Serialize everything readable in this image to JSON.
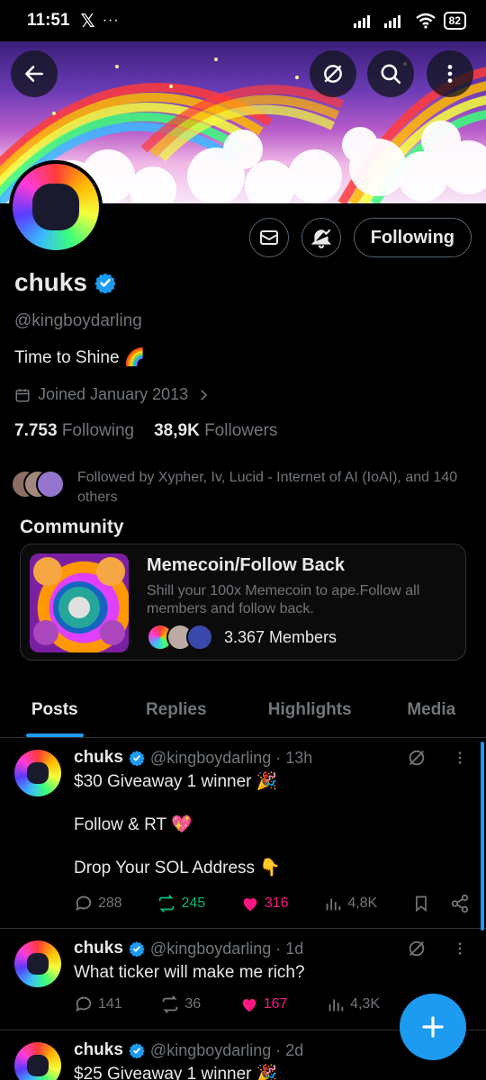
{
  "status_bar": {
    "time": "11:51",
    "app_icon": "x-logo",
    "more": "···",
    "battery": "82"
  },
  "profile": {
    "display_name": "chuks",
    "handle": "@kingboydarling",
    "bio": "Time to Shine 🌈",
    "joined": "Joined January 2013",
    "following_count": "7.753",
    "following_label": "Following",
    "followers_count": "38,9K",
    "followers_label": "Followers",
    "follow_button_label": "Following",
    "followed_by": "Followed by Xypher, Iv, Lucid - Internet of AI (IoAI), and 140 others"
  },
  "community": {
    "section_title": "Community",
    "name": "Memecoin/Follow Back",
    "description": "Shill your 100x Memecoin to ape.Follow all members and follow back.",
    "members": "3.367 Members"
  },
  "tabs": [
    {
      "label": "Posts",
      "active": true
    },
    {
      "label": "Replies",
      "active": false
    },
    {
      "label": "Highlights",
      "active": false
    },
    {
      "label": "Media",
      "active": false
    }
  ],
  "posts": [
    {
      "name": "chuks",
      "meta": "@kingboydarling · 13h",
      "lines": [
        "$30 Giveaway 1 winner 🎉",
        "",
        "Follow & RT 💖",
        "",
        "Drop Your SOL Address 👇"
      ],
      "replies": "288",
      "reposts": "245",
      "likes": "316",
      "views": "4,8K"
    },
    {
      "name": "chuks",
      "meta": "@kingboydarling · 1d",
      "lines": [
        "What ticker will make me rich?"
      ],
      "replies": "141",
      "reposts": "36",
      "likes": "167",
      "views": "4,3K"
    },
    {
      "name": "chuks",
      "meta": "@kingboydarling · 2d",
      "lines": [
        "$25 Giveaway 1 winner 🎉"
      ]
    }
  ],
  "colors": {
    "accent": "#1d9bf0",
    "repost_active": "#00ba7c",
    "like_active": "#f91880",
    "muted": "#71767b",
    "border": "#2f3336"
  }
}
